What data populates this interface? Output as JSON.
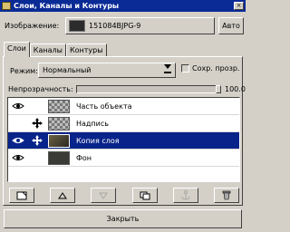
{
  "window": {
    "title": "Слои, Каналы и Контуры",
    "title_bar_color": "#0a2a96",
    "close_glyph": "×"
  },
  "image_row": {
    "label": "Изображение:",
    "selected_image": "151084BJPG-9",
    "auto_label": "Авто"
  },
  "tabs": [
    {
      "label": "Слои",
      "active": true
    },
    {
      "label": "Каналы",
      "active": false
    },
    {
      "label": "Контуры",
      "active": false
    }
  ],
  "layers_panel": {
    "mode_label": "Режим:",
    "mode_value": "Нормальный",
    "keep_transparency_label": "Сохр. прозр.",
    "keep_transparency_checked": false,
    "opacity_label": "Непрозрачность:",
    "opacity_value": "100.0",
    "opacity_fraction": 1.0,
    "selection_color": "#08248a",
    "layers": [
      {
        "name": "Часть объекта",
        "visible": true,
        "linked": false,
        "thumbnail": "checkerboard",
        "selected": false
      },
      {
        "name": "Надпись",
        "visible": false,
        "linked": true,
        "thumbnail": "checkerboard",
        "selected": false
      },
      {
        "name": "Копия слоя",
        "visible": true,
        "linked": true,
        "thumbnail": "photo",
        "selected": true
      },
      {
        "name": "Фон",
        "visible": true,
        "linked": false,
        "thumbnail": "dark",
        "selected": false
      }
    ],
    "toolbar_icons": [
      "new-layer-icon",
      "raise-layer-icon",
      "lower-layer-icon",
      "duplicate-layer-icon",
      "anchor-layer-icon",
      "delete-layer-icon"
    ]
  },
  "close_button_label": "Закрыть"
}
